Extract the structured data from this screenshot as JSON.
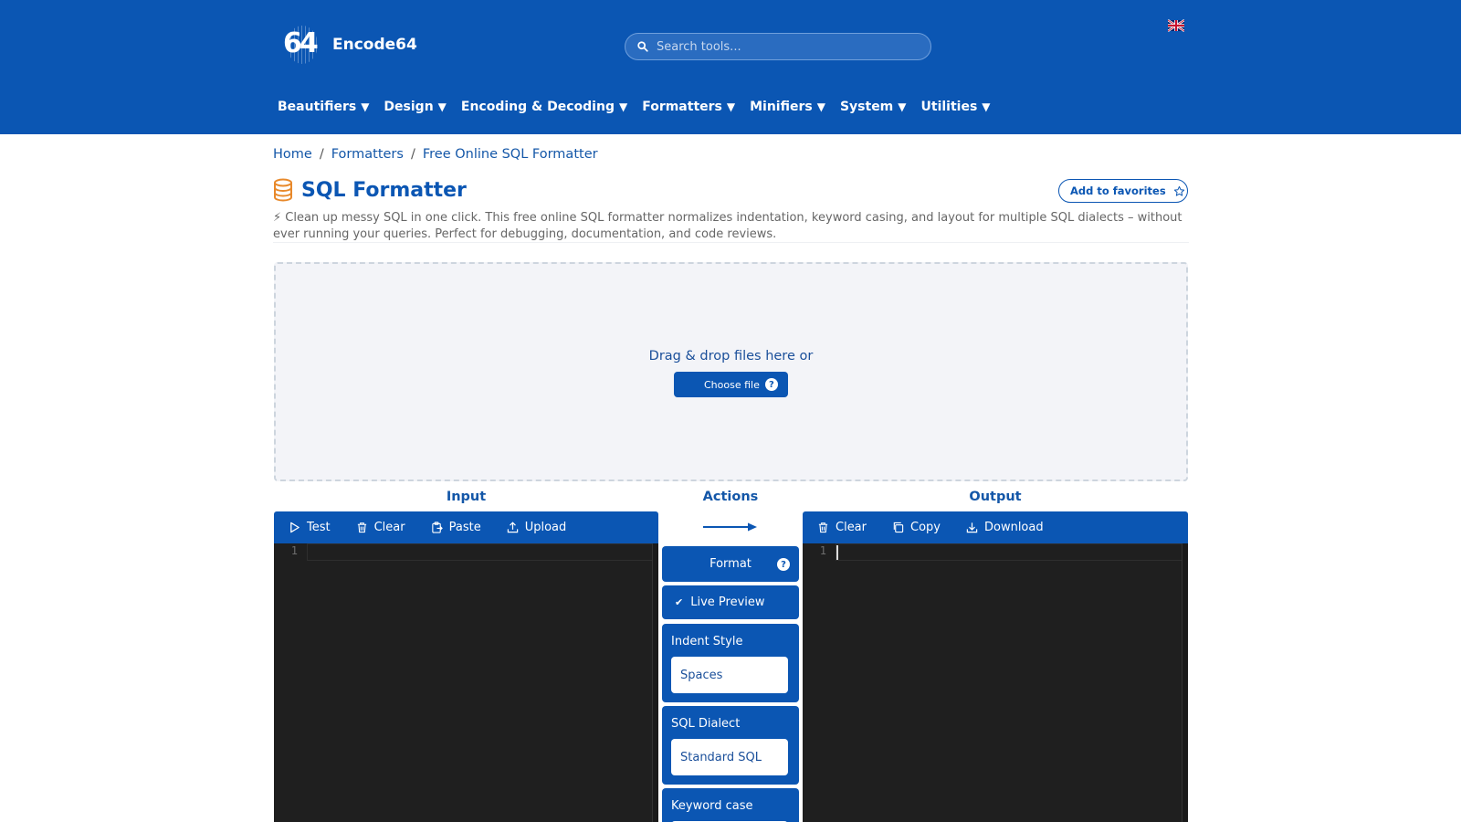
{
  "site": {
    "name": "Encode64",
    "logo_text": "64"
  },
  "search": {
    "placeholder": "Search tools..."
  },
  "nav": [
    "Beautifiers",
    "Design",
    "Encoding & Decoding",
    "Formatters",
    "Minifiers",
    "System",
    "Utilities"
  ],
  "breadcrumb": [
    "Home",
    "Formatters",
    "Free Online SQL Formatter"
  ],
  "page": {
    "title": "SQL Formatter",
    "favorites_label": "Add to favorites",
    "description": "⚡ Clean up messy SQL in one click. This free online SQL formatter normalizes indentation, keyword casing, and layout for multiple SQL dialects – without ever running your queries. Perfect for debugging, documentation, and code reviews."
  },
  "dropzone": {
    "text": "Drag & drop files here or",
    "button": "Choose file",
    "help": "?"
  },
  "input": {
    "label": "Input",
    "tools": [
      "Test",
      "Clear",
      "Paste",
      "Upload"
    ],
    "line_number": "1"
  },
  "actions": {
    "label": "Actions",
    "format_label": "Format",
    "live_preview_label": "Live Preview",
    "indent_style_label": "Indent Style",
    "indent_style_value": "Spaces",
    "sql_dialect_label": "SQL Dialect",
    "sql_dialect_value": "Standard SQL",
    "keyword_case_label": "Keyword case"
  },
  "output": {
    "label": "Output",
    "tools": [
      "Clear",
      "Copy",
      "Download"
    ],
    "line_number": "1"
  },
  "colors": {
    "primary": "#0b56b3",
    "editor_bg": "#1f1f1f",
    "dropzone_bg": "#f3f4f8"
  }
}
